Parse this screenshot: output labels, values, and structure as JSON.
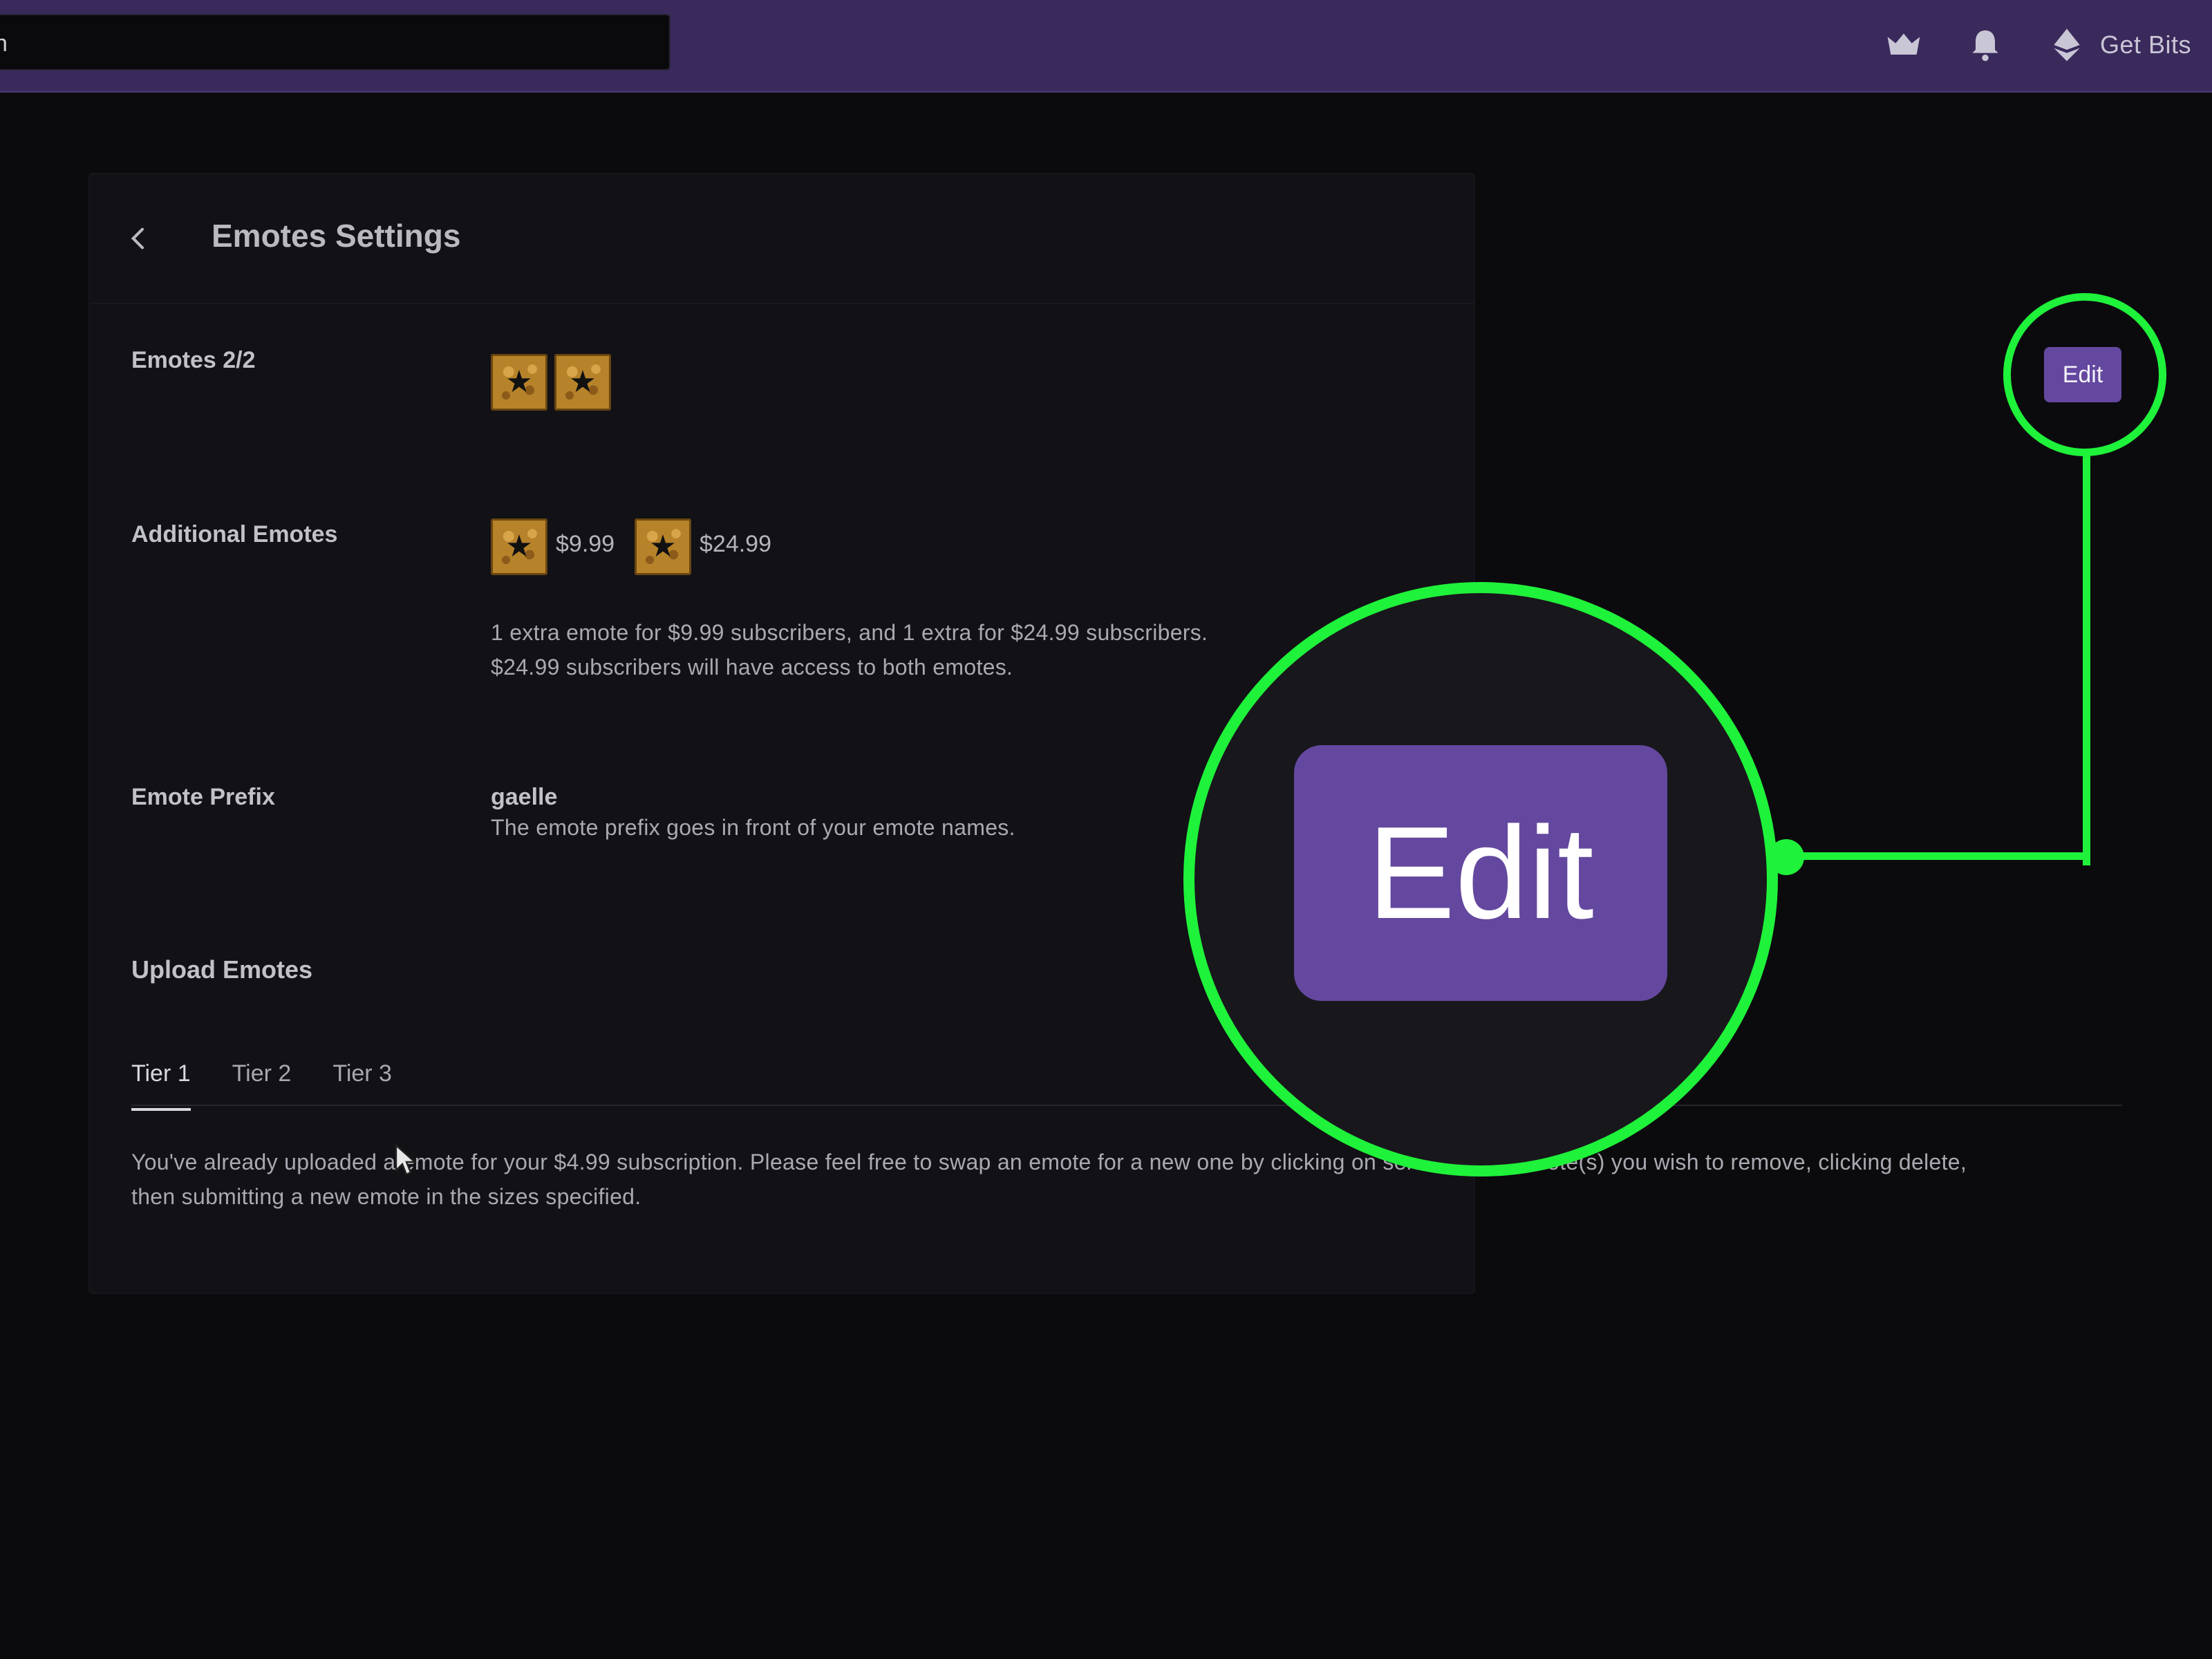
{
  "topbar": {
    "search_text": "n",
    "get_bits_label": "Get Bits",
    "icons": [
      "crown-icon",
      "bell-icon",
      "bits-icon"
    ]
  },
  "page": {
    "title": "Emotes Settings"
  },
  "emotes": {
    "label": "Emotes 2/2",
    "edit_label": "Edit"
  },
  "additional": {
    "label": "Additional Emotes",
    "price_1": "$9.99",
    "price_2": "$24.99",
    "desc_line1": "1 extra emote for $9.99 subscribers, and 1 extra for $24.99 subscribers.",
    "desc_line2": "$24.99 subscribers will have access to both emotes."
  },
  "prefix": {
    "label": "Emote Prefix",
    "value": "gaelle",
    "desc": "The emote prefix goes in front of your emote names."
  },
  "upload": {
    "label": "Upload Emotes",
    "tabs": [
      "Tier 1",
      "Tier 2",
      "Tier 3"
    ],
    "active_tab": "Tier 1",
    "desc_line1": "You've already uploaded a emote for your $4.99 subscription. Please feel free to swap an emote for a new one by clicking on selecting the emote(s) you wish to remove, clicking delete,",
    "desc_line2": "then submitting a new emote in the sizes specified."
  },
  "callout": {
    "zoom_label": "Edit",
    "highlight_color": "#1ff23a"
  },
  "colors": {
    "topbar": "#3a2a5c",
    "background": "#0b0b0e",
    "panel": "#111116",
    "accent_purple": "#64489f",
    "emote_gold": "#b7832a"
  }
}
